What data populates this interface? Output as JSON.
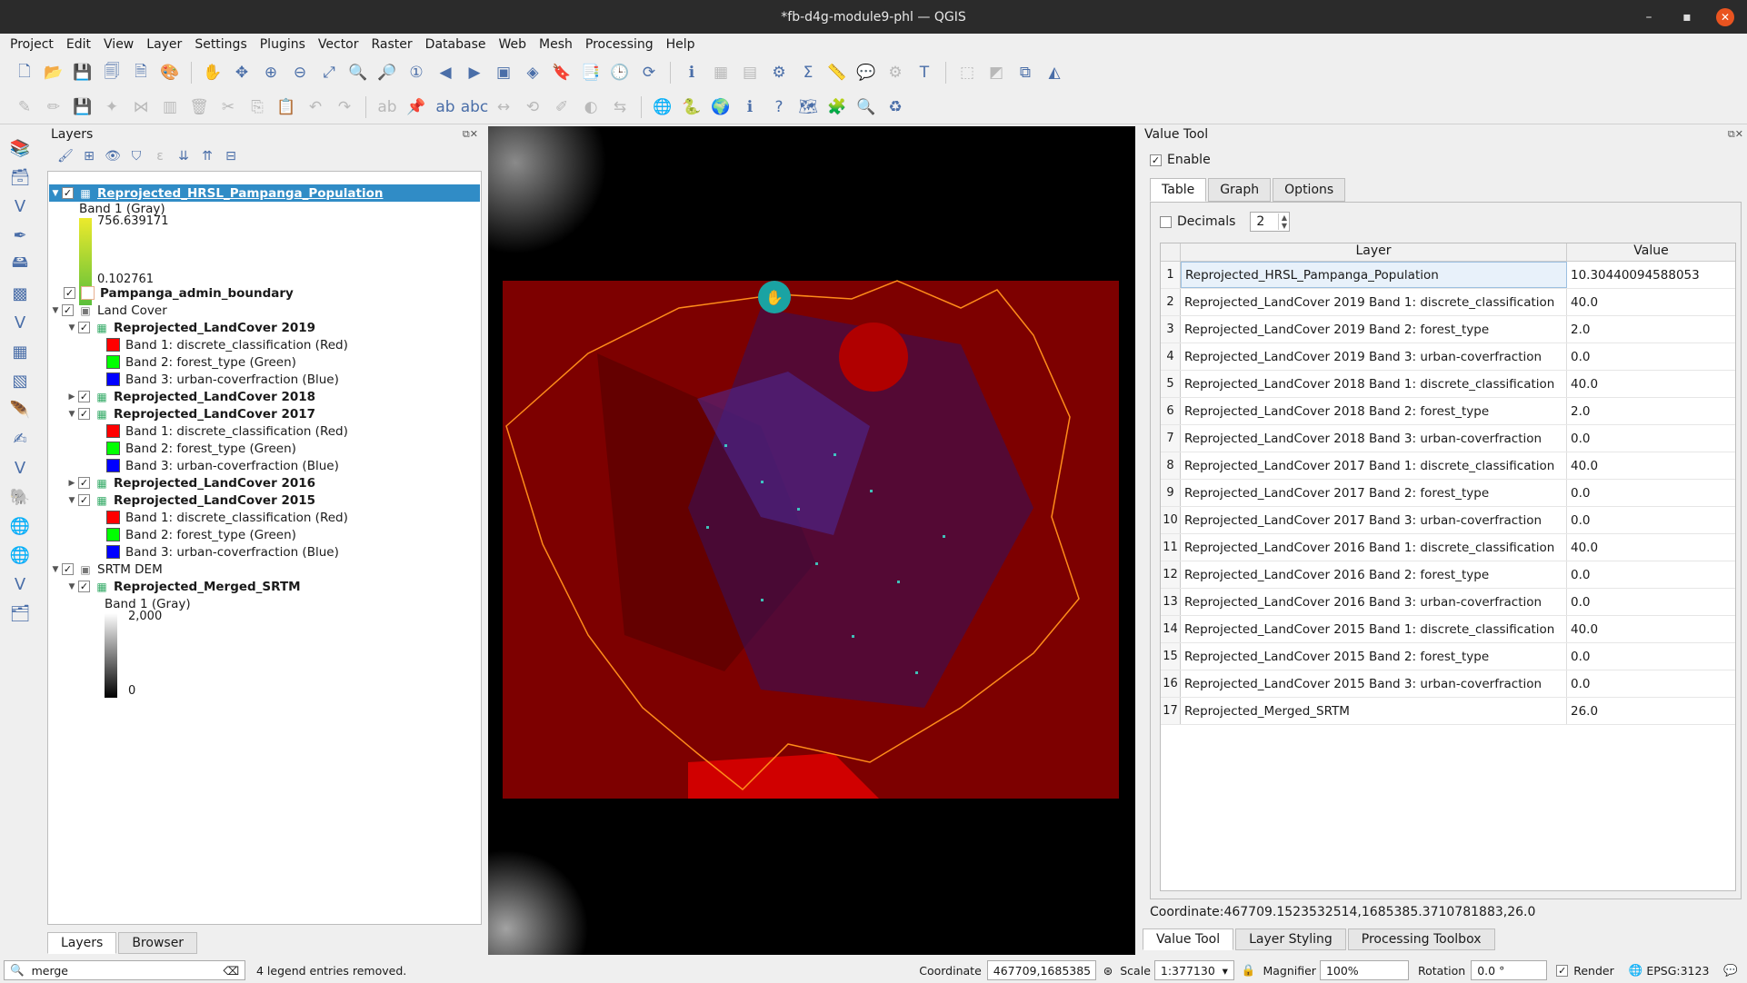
{
  "window": {
    "title": "*fb-d4g-module9-phl — QGIS"
  },
  "menu": [
    "Project",
    "Edit",
    "View",
    "Layer",
    "Settings",
    "Plugins",
    "Vector",
    "Raster",
    "Database",
    "Web",
    "Mesh",
    "Processing",
    "Help"
  ],
  "layers_panel": {
    "title": "Layers",
    "tree": {
      "pop": {
        "name": "Reprojected_HRSL_Pampanga_Population",
        "band": "Band 1 (Gray)",
        "max": "756.639171",
        "min": "0.102761"
      },
      "boundary": {
        "name": "Pampanga_admin_boundary"
      },
      "landcover_group": {
        "name": "Land Cover"
      },
      "lc2019": {
        "name": "Reprojected_LandCover 2019",
        "b1": "Band 1: discrete_classification (Red)",
        "b2": "Band 2: forest_type (Green)",
        "b3": "Band 3: urban-coverfraction (Blue)"
      },
      "lc2018": {
        "name": "Reprojected_LandCover 2018"
      },
      "lc2017": {
        "name": "Reprojected_LandCover 2017",
        "b1": "Band 1: discrete_classification (Red)",
        "b2": "Band 2: forest_type (Green)",
        "b3": "Band 3: urban-coverfraction (Blue)"
      },
      "lc2016": {
        "name": "Reprojected_LandCover 2016"
      },
      "lc2015": {
        "name": "Reprojected_LandCover 2015",
        "b1": "Band 1: discrete_classification (Red)",
        "b2": "Band 2: forest_type (Green)",
        "b3": "Band 3: urban-coverfraction (Blue)"
      },
      "srtm_group": {
        "name": "SRTM DEM"
      },
      "srtm": {
        "name": "Reprojected_Merged_SRTM",
        "band": "Band 1 (Gray)",
        "max": "2,000",
        "min": "0"
      }
    },
    "tabs": [
      "Layers",
      "Browser"
    ]
  },
  "value_tool": {
    "title": "Value Tool",
    "enable_label": "Enable",
    "tabs": [
      "Table",
      "Graph",
      "Options"
    ],
    "decimals_label": "Decimals",
    "decimals_value": "2",
    "col_layer": "Layer",
    "col_value": "Value",
    "rows": [
      {
        "n": "1",
        "layer": "Reprojected_HRSL_Pampanga_Population",
        "value": "10.30440094588053"
      },
      {
        "n": "2",
        "layer": "Reprojected_LandCover 2019 Band 1: discrete_classification",
        "value": "40.0"
      },
      {
        "n": "3",
        "layer": "Reprojected_LandCover 2019 Band 2: forest_type",
        "value": "2.0"
      },
      {
        "n": "4",
        "layer": "Reprojected_LandCover 2019 Band 3: urban-coverfraction",
        "value": "0.0"
      },
      {
        "n": "5",
        "layer": "Reprojected_LandCover 2018 Band 1: discrete_classification",
        "value": "40.0"
      },
      {
        "n": "6",
        "layer": "Reprojected_LandCover 2018 Band 2: forest_type",
        "value": "2.0"
      },
      {
        "n": "7",
        "layer": "Reprojected_LandCover 2018 Band 3: urban-coverfraction",
        "value": "0.0"
      },
      {
        "n": "8",
        "layer": "Reprojected_LandCover 2017 Band 1: discrete_classification",
        "value": "40.0"
      },
      {
        "n": "9",
        "layer": "Reprojected_LandCover 2017 Band 2: forest_type",
        "value": "0.0"
      },
      {
        "n": "10",
        "layer": "Reprojected_LandCover 2017 Band 3: urban-coverfraction",
        "value": "0.0"
      },
      {
        "n": "11",
        "layer": "Reprojected_LandCover 2016 Band 1: discrete_classification",
        "value": "40.0"
      },
      {
        "n": "12",
        "layer": "Reprojected_LandCover 2016 Band 2: forest_type",
        "value": "0.0"
      },
      {
        "n": "13",
        "layer": "Reprojected_LandCover 2016 Band 3: urban-coverfraction",
        "value": "0.0"
      },
      {
        "n": "14",
        "layer": "Reprojected_LandCover 2015 Band 1: discrete_classification",
        "value": "40.0"
      },
      {
        "n": "15",
        "layer": "Reprojected_LandCover 2015 Band 2: forest_type",
        "value": "0.0"
      },
      {
        "n": "16",
        "layer": "Reprojected_LandCover 2015 Band 3: urban-coverfraction",
        "value": "0.0"
      },
      {
        "n": "17",
        "layer": "Reprojected_Merged_SRTM",
        "value": "26.0"
      }
    ],
    "coordinate_text": "Coordinate:467709.1523532514,1685385.3710781883,26.0",
    "bottom_tabs": [
      "Value Tool",
      "Layer Styling",
      "Processing Toolbox"
    ]
  },
  "status": {
    "search_value": "merge",
    "message": "4 legend entries removed.",
    "coordinate_label": "Coordinate",
    "coordinate_value": "467709,1685385",
    "scale_label": "Scale",
    "scale_value": "1:377130",
    "magnifier_label": "Magnifier",
    "magnifier_value": "100%",
    "rotation_label": "Rotation",
    "rotation_value": "0.0 °",
    "render_label": "Render",
    "crs": "EPSG:3123"
  }
}
